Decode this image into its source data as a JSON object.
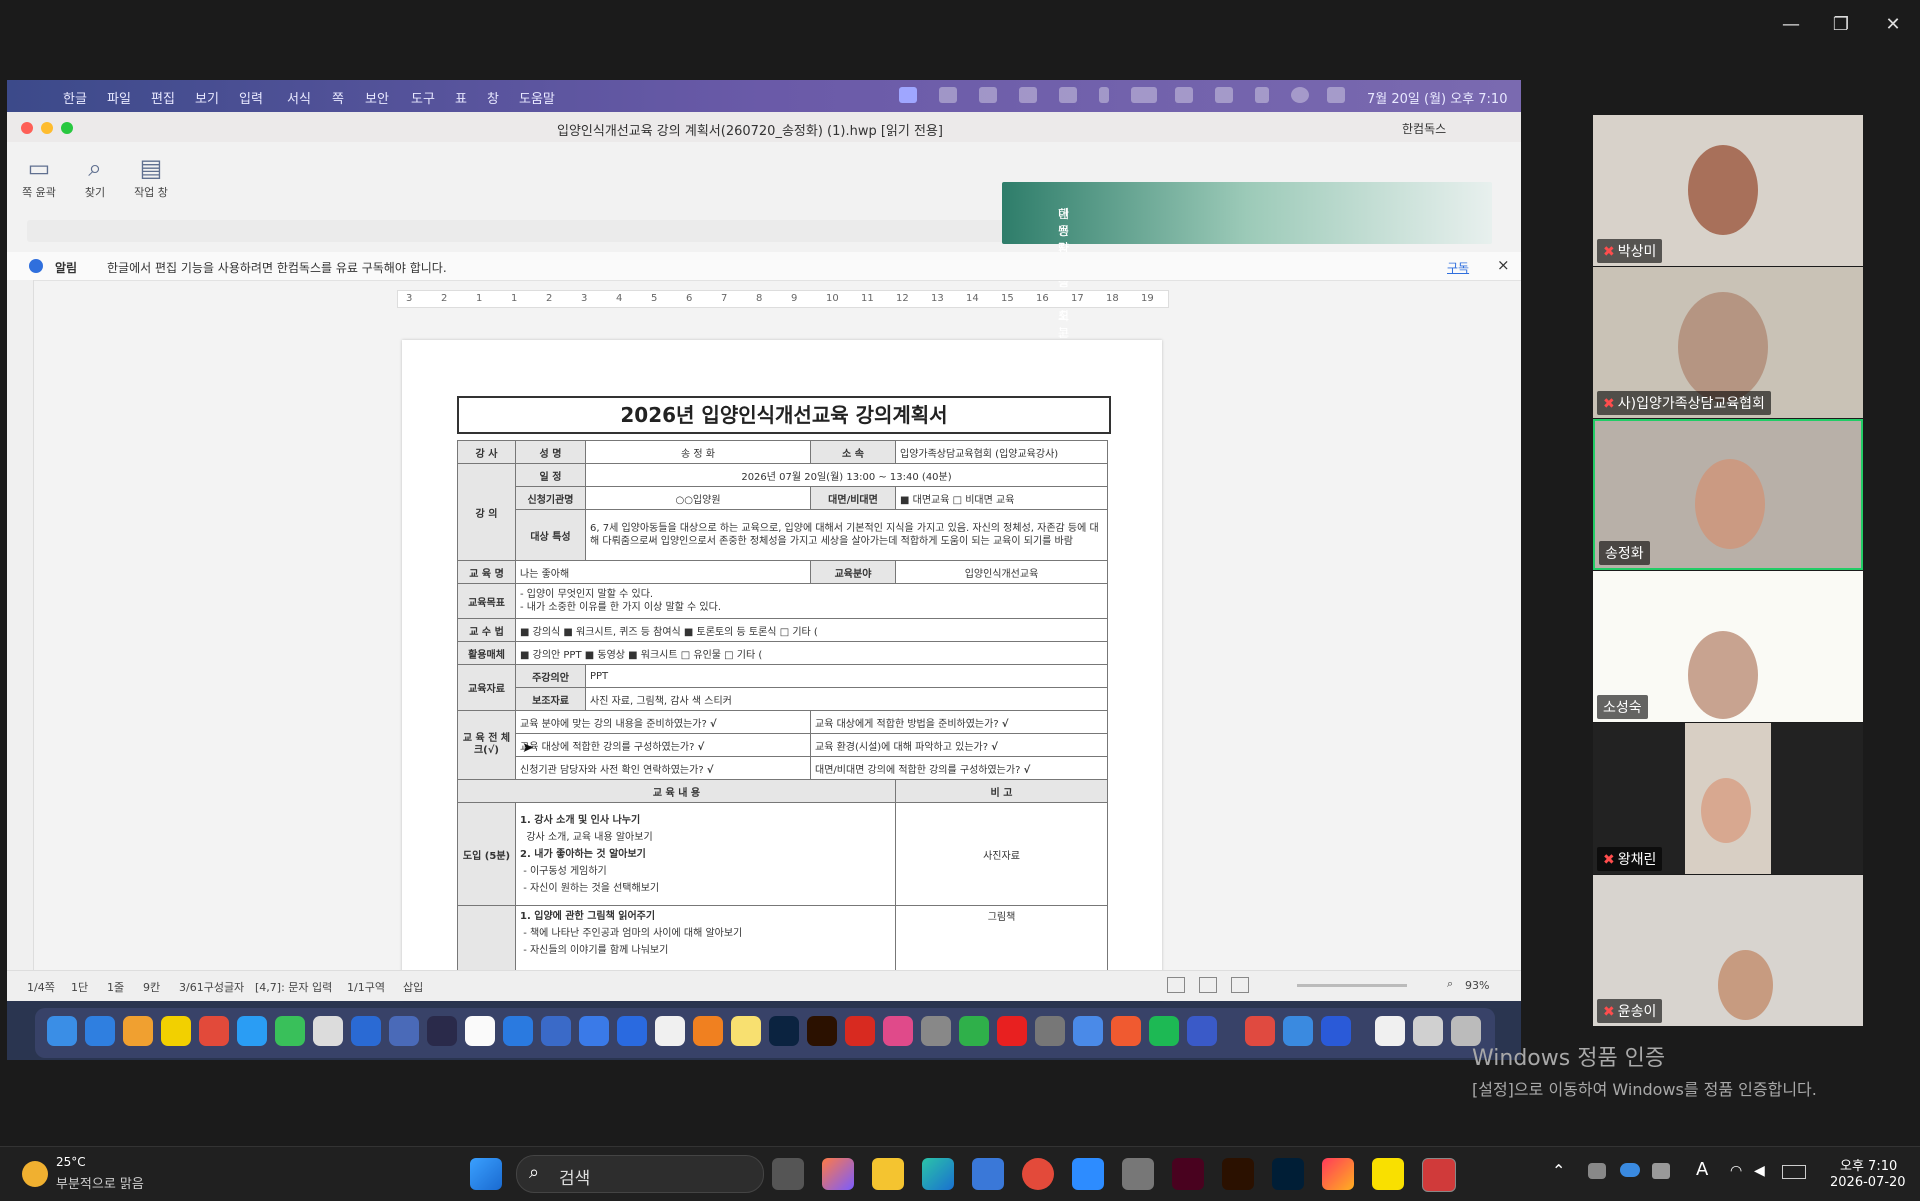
{
  "window_controls": {
    "minimize": "—",
    "restore": "❐",
    "close": "✕"
  },
  "shared_screen": {
    "mac_menu": [
      "한글",
      "파일",
      "편집",
      "보기",
      "입력",
      "서식",
      "쪽",
      "보안",
      "도구",
      "표",
      "창",
      "도움말"
    ],
    "mac_clock": "7월 20일 (월) 오후 7:10",
    "doc_window_title": "입양인식개선교육 강의 계획서(260720_송정화) (1).hwp [읽기 전용]",
    "account_label": "한컴독스",
    "toolbar_buttons": [
      "쪽 윤곽",
      "찾기",
      "작업 창"
    ],
    "ad_text": [
      "한번 자주 놀러오는 캠핑족은",
      "대용량 가성비 최고 세트"
    ],
    "notice_label": "알림",
    "notice_text": "한글에서 편집 기능을 사용하려면 한컴독스를 유료 구독해야 합니다.",
    "notice_link": "구독",
    "ruler_ticks": [
      "3",
      "2",
      "1",
      "1",
      "2",
      "3",
      "4",
      "5",
      "6",
      "7",
      "8",
      "9",
      "10",
      "11",
      "12",
      "13",
      "14",
      "15",
      "16",
      "17",
      "18",
      "19"
    ],
    "doc_title": "2026년 입양인식개선교육 강의계획서",
    "doc": {
      "instructor_label": "강 사",
      "name_label": "성 명",
      "name_value": "송 정 화",
      "org_label": "소 속",
      "org_value": "입양가족상담교육협회 (입양교육강사)",
      "lecture_label": "강 의",
      "date_label": "일 정",
      "date_value": "2026년 07월 20일(월) 13:00 ~ 13:40 (40분)",
      "agency_label": "신청기관명",
      "agency_value": "○○입양원",
      "mode_label": "대면/비대면",
      "mode_value": "■ 대면교육 □ 비대면 교육",
      "target_label": "대상 특성",
      "target_value": "6, 7세 입양아동들을 대상으로 하는 교육으로, 입양에 대해서 기본적인 지식을 가지고 있음. 자신의 정체성, 자존감 등에 대해 다뤄줌으로써 입양인으로서 존중한 정체성을 가지고 세상을 살아가는데 적합하게 도움이 되는 교육이 되기를 바람",
      "course_label": "교 육 명",
      "course_value": "나는 좋아해",
      "field_label": "교육분야",
      "field_value": "입양인식개선교육",
      "goal_label": "교육목표",
      "goal_values": [
        "- 입양이 무엇인지 말할 수 있다.",
        "- 내가 소중한 이유를 한 가지 이상 말할 수 있다."
      ],
      "method_label": "교 수 법",
      "method_value": "■ 강의식 ■ 워크시트, 퀴즈 등 참여식 ■ 토론토의 등 토론식 □ 기타 (",
      "media_label": "활용매체",
      "media_value": "■ 강의안 PPT ■ 동영상 ■ 워크시트 □ 유인물 □ 기타 (",
      "material_label": "교육자료",
      "material_rows": [
        {
          "k": "주강의안",
          "v": "PPT"
        },
        {
          "k": "보조자료",
          "v": "사진 자료, 그림책, 감사 색 스티커"
        }
      ],
      "check_label": "교 육 전 체크(√)",
      "check_rows": [
        {
          "a": "교육 분야에 맞는 강의 내용을 준비하였는가?",
          "b": "교육 대상에게 적합한 방법을 준비하였는가?"
        },
        {
          "a": "교육 대상에 적합한 강의를 구성하였는가?",
          "b": "교육 환경(시설)에 대해 파악하고 있는가?"
        },
        {
          "a": "신청기관 담당자와 사전 확인 연락하였는가?",
          "b": "대면/비대면 강의에 적합한 강의를 구성하였는가?"
        }
      ],
      "check_mark": "√",
      "content_header": "교 육 내 용",
      "note_header": "비 고",
      "intro_label": "도입 (5분)",
      "intro_lines": [
        "1. 강사 소개 및 인사 나누기",
        "강사 소개, 교육 내용 알아보기",
        "2. 내가 좋아하는 것 알아보기",
        "- 이구동성 게임하기",
        "- 자신이 원하는 것을 선택해보기"
      ],
      "intro_note": "사진자료",
      "body_lines": [
        "1. 입양에 관한 그림책 읽어주기",
        "- 책에 나타난 주인공과 엄마의 사이에 대해 알아보기",
        "- 자신들의 이야기를 함께 나눠보기"
      ],
      "body_note": "그림책"
    },
    "status_items": [
      "1/4쪽",
      "1단",
      "1줄",
      "9칸",
      "3/61구성글자",
      "[4,7]: 문자 입력",
      "1/1구역",
      "삽입"
    ],
    "zoom_level": "93%"
  },
  "participants": [
    {
      "name": "박상미",
      "muted": true
    },
    {
      "name": "사)입양가족상담교육협회",
      "muted": true
    },
    {
      "name": "송정화",
      "muted": false,
      "active": true
    },
    {
      "name": "소성숙",
      "muted": false
    },
    {
      "name": "왕채린",
      "muted": true
    },
    {
      "name": "윤송이",
      "muted": true
    }
  ],
  "activation": {
    "title": "Windows 정품 인증",
    "subtitle": "[설정]으로 이동하여 Windows를 정품 인증합니다."
  },
  "taskbar": {
    "weather_temp": "25°C",
    "weather_desc": "부분적으로 맑음",
    "search_placeholder": "검색",
    "time": "오후 7:10",
    "date": "2026-07-20",
    "tray_ime": "A"
  },
  "colors": {
    "active_speaker": "#22cc66",
    "mute": "#ff4d4d"
  }
}
